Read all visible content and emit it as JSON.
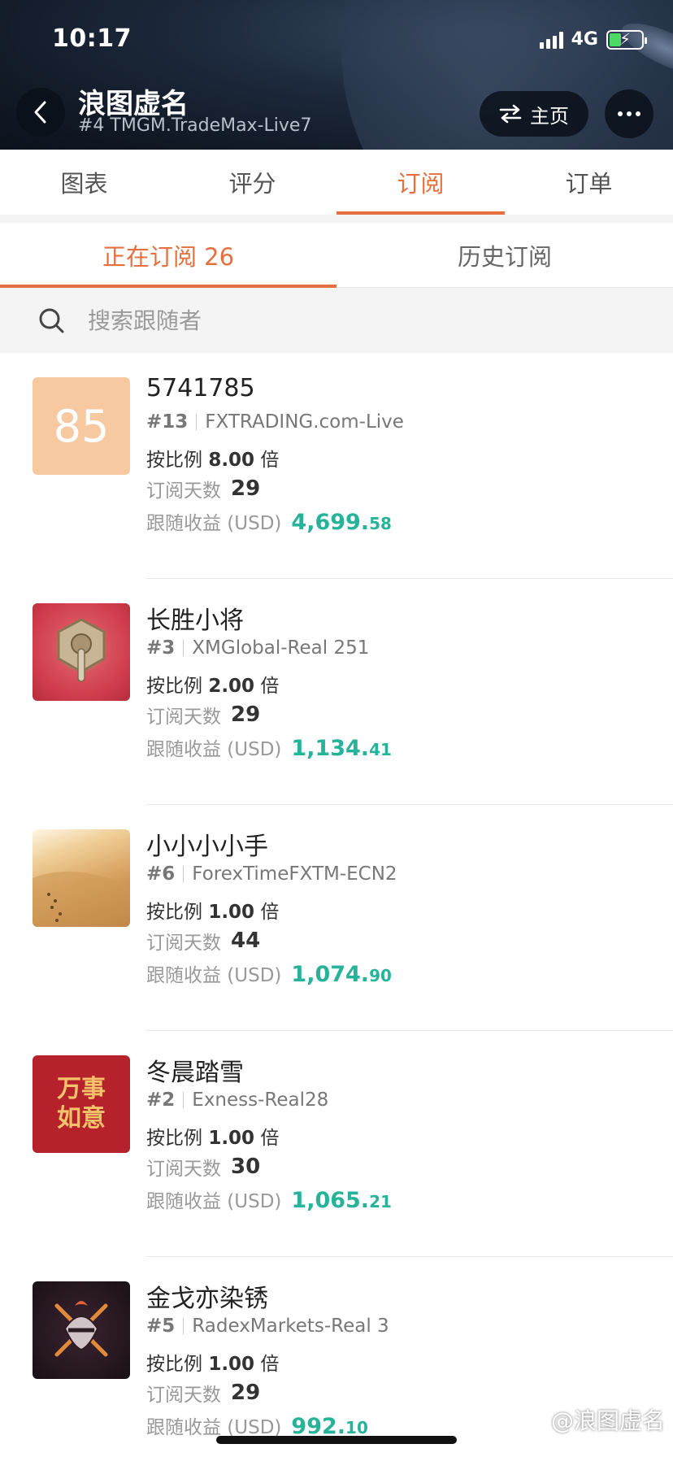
{
  "status": {
    "time": "10:17",
    "network": "4G"
  },
  "header": {
    "title": "浪图虚名",
    "subtitle": "#4 TMGM.TradeMax-Live7",
    "home_label": "主页"
  },
  "main_tabs": [
    {
      "label": "图表"
    },
    {
      "label": "评分"
    },
    {
      "label": "订阅"
    },
    {
      "label": "订单"
    }
  ],
  "sub_tabs": [
    {
      "label": "正在订阅 26"
    },
    {
      "label": "历史订阅"
    }
  ],
  "search": {
    "placeholder": "搜索跟随者"
  },
  "labels": {
    "ratio_prefix": "按比例",
    "ratio_suffix": "倍",
    "days": "订阅天数",
    "profit": "跟随收益 (USD)"
  },
  "followers": [
    {
      "avatar_text": "85",
      "name": "5741785",
      "rank": "#13",
      "broker": "FXTRADING.com-Live",
      "ratio": "8.00",
      "days": "29",
      "profit_int": "4,699.",
      "profit_dec": "58"
    },
    {
      "avatar_text": "",
      "name": "长胜小将",
      "rank": "#3",
      "broker": "XMGlobal-Real 251",
      "ratio": "2.00",
      "days": "29",
      "profit_int": "1,134.",
      "profit_dec": "41"
    },
    {
      "avatar_text": "",
      "name": "小小小小手",
      "rank": "#6",
      "broker": "ForexTimeFXTM-ECN2",
      "ratio": "1.00",
      "days": "44",
      "profit_int": "1,074.",
      "profit_dec": "90"
    },
    {
      "avatar_text": "万事如意",
      "name": "冬晨踏雪",
      "rank": "#2",
      "broker": "Exness-Real28",
      "ratio": "1.00",
      "days": "30",
      "profit_int": "1,065.",
      "profit_dec": "21"
    },
    {
      "avatar_text": "",
      "name": "金戈亦染锈",
      "rank": "#5",
      "broker": "RadexMarkets-Real 3",
      "ratio": "1.00",
      "days": "29",
      "profit_int": "992.",
      "profit_dec": "10"
    }
  ],
  "watermark": "@浪图虚名",
  "colors": {
    "accent": "#e5703f",
    "profit": "#27b39a"
  }
}
